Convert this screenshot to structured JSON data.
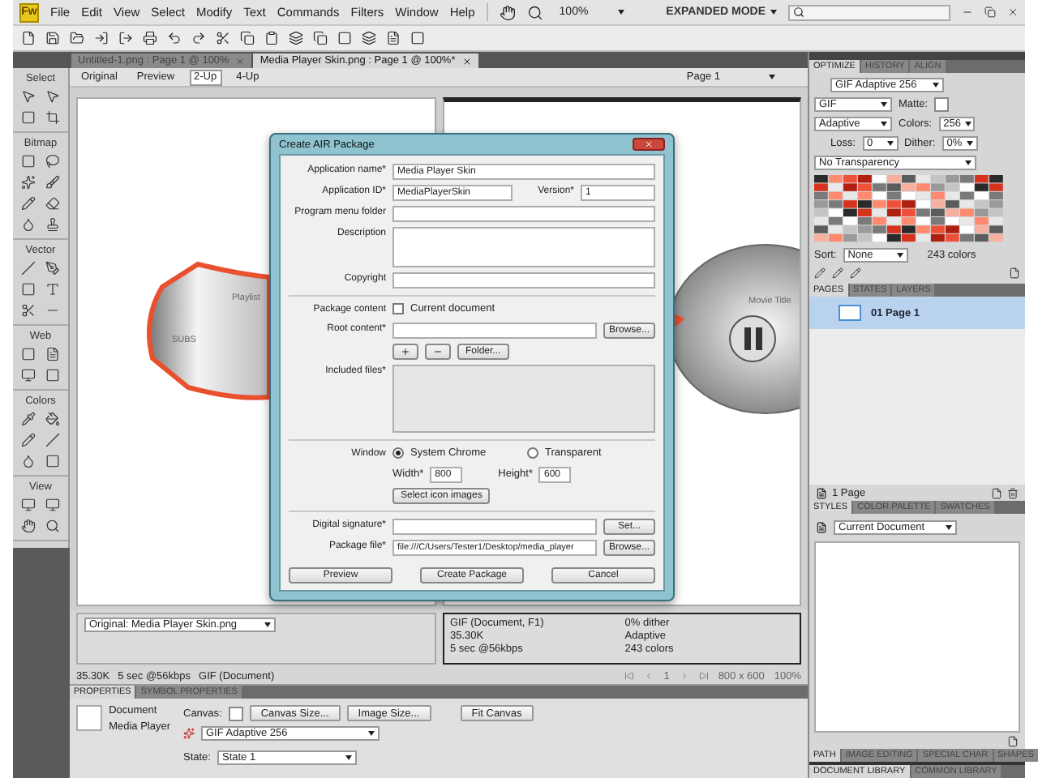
{
  "app": {
    "logo": "Fw",
    "menu": [
      "File",
      "Edit",
      "View",
      "Select",
      "Modify",
      "Text",
      "Commands",
      "Filters",
      "Window",
      "Help"
    ],
    "zoom": "100%",
    "mode": "EXPANDED MODE"
  },
  "doc_tabs": [
    {
      "label": "Untitled-1.png : Page 1 @ 100%",
      "selected": false
    },
    {
      "label": "Media Player Skin.png : Page 1 @ 100%*",
      "selected": true
    }
  ],
  "tools_panel": {
    "sections": [
      "Select",
      "Bitmap",
      "Vector",
      "Web",
      "Colors",
      "View"
    ]
  },
  "view_bar": {
    "modes": [
      {
        "label": "Original",
        "selected": false
      },
      {
        "label": "Preview",
        "selected": false
      },
      {
        "label": "2-Up",
        "selected": true
      },
      {
        "label": "4-Up",
        "selected": false
      }
    ],
    "page": "Page 1"
  },
  "canvas": {
    "left_labels": [
      "Playlist",
      "SUBS"
    ],
    "right_label": "Movie Title"
  },
  "dialog": {
    "title": "Create AIR Package",
    "app_name": {
      "label": "Application name*",
      "value": "Media Player Skin"
    },
    "app_id": {
      "label": "Application ID*",
      "value": "MediaPlayerSkin"
    },
    "version": {
      "label": "Version*",
      "value": "1"
    },
    "menu_folder": {
      "label": "Program menu folder"
    },
    "description": {
      "label": "Description"
    },
    "copyright": {
      "label": "Copyright"
    },
    "package_content": {
      "label": "Package content",
      "option": "Current document",
      "checked": false
    },
    "root_content": {
      "label": "Root content*",
      "button": "Browse..."
    },
    "folder_button": "Folder...",
    "included_files": {
      "label": "Included files*"
    },
    "window": {
      "label": "Window",
      "options": [
        {
          "label": "System Chrome",
          "selected": true
        },
        {
          "label": "Transparent",
          "selected": false
        }
      ]
    },
    "width": {
      "label": "Width*",
      "value": "800"
    },
    "height": {
      "label": "Height*",
      "value": "600"
    },
    "icon_button": "Select icon images",
    "signature": {
      "label": "Digital signature*",
      "button": "Set..."
    },
    "package_file": {
      "label": "Package file*",
      "value": "file:///C/Users/Tester1/Desktop/media_player",
      "button": "Browse..."
    },
    "buttons": [
      "Preview",
      "Create Package",
      "Cancel"
    ]
  },
  "preview_info": {
    "original": "Original: Media Player Skin.png",
    "format": "GIF (Document, F1)",
    "size": "35.30K",
    "time": "5 sec @56kbps",
    "dither": "0% dither",
    "palette": "Adaptive",
    "colors": "243 colors"
  },
  "status_bar": {
    "size": "35.30K",
    "time": "5 sec @56kbps",
    "format": "GIF (Document)",
    "page": "1",
    "dimensions": "800 x 600",
    "zoom": "100%"
  },
  "properties": {
    "tabs": [
      {
        "label": "PROPERTIES",
        "selected": true
      },
      {
        "label": "SYMBOL PROPERTIES",
        "selected": false
      }
    ],
    "type": "Document",
    "name": "Media Player",
    "canvas_label": "Canvas:",
    "buttons": [
      "Canvas Size...",
      "Image Size...",
      "Fit Canvas"
    ],
    "optimize": "GIF Adaptive 256",
    "state_label": "State:",
    "state": "State 1"
  },
  "optimize_panel": {
    "tabs": [
      {
        "label": "OPTIMIZE",
        "selected": true
      },
      {
        "label": "HISTORY",
        "selected": false
      },
      {
        "label": "ALIGN",
        "selected": false
      }
    ],
    "preset": "GIF Adaptive 256",
    "format": "GIF",
    "matte_label": "Matte:",
    "palette": "Adaptive",
    "colors_label": "Colors:",
    "colors": "256",
    "loss_label": "Loss:",
    "loss": "0",
    "dither_label": "Dither:",
    "dither": "0%",
    "transparency": "No Transparency",
    "sort_label": "Sort:",
    "sort": "None",
    "color_count": "243 colors"
  },
  "pages_panel": {
    "tabs": [
      {
        "label": "PAGES",
        "selected": true
      },
      {
        "label": "STATES",
        "selected": false
      },
      {
        "label": "LAYERS",
        "selected": false
      }
    ],
    "pages": [
      {
        "label": "01 Page 1",
        "selected": true
      }
    ],
    "count": "1 Page"
  },
  "styles_panel": {
    "tabs": [
      {
        "label": "STYLES",
        "selected": true
      },
      {
        "label": "COLOR PALETTE",
        "selected": false
      },
      {
        "label": "SWATCHES",
        "selected": false
      }
    ],
    "library": "Current Document"
  },
  "bottom_panels": {
    "tabs": [
      {
        "label": "PATH",
        "selected": true
      },
      {
        "label": "IMAGE EDITING",
        "selected": false
      },
      {
        "label": "SPECIAL CHAR",
        "selected": false
      },
      {
        "label": "SHAPES",
        "selected": false
      }
    ],
    "libraries": [
      {
        "label": "DOCUMENT LIBRARY",
        "selected": true
      },
      {
        "label": "COMMON LIBRARY",
        "selected": false
      }
    ]
  }
}
